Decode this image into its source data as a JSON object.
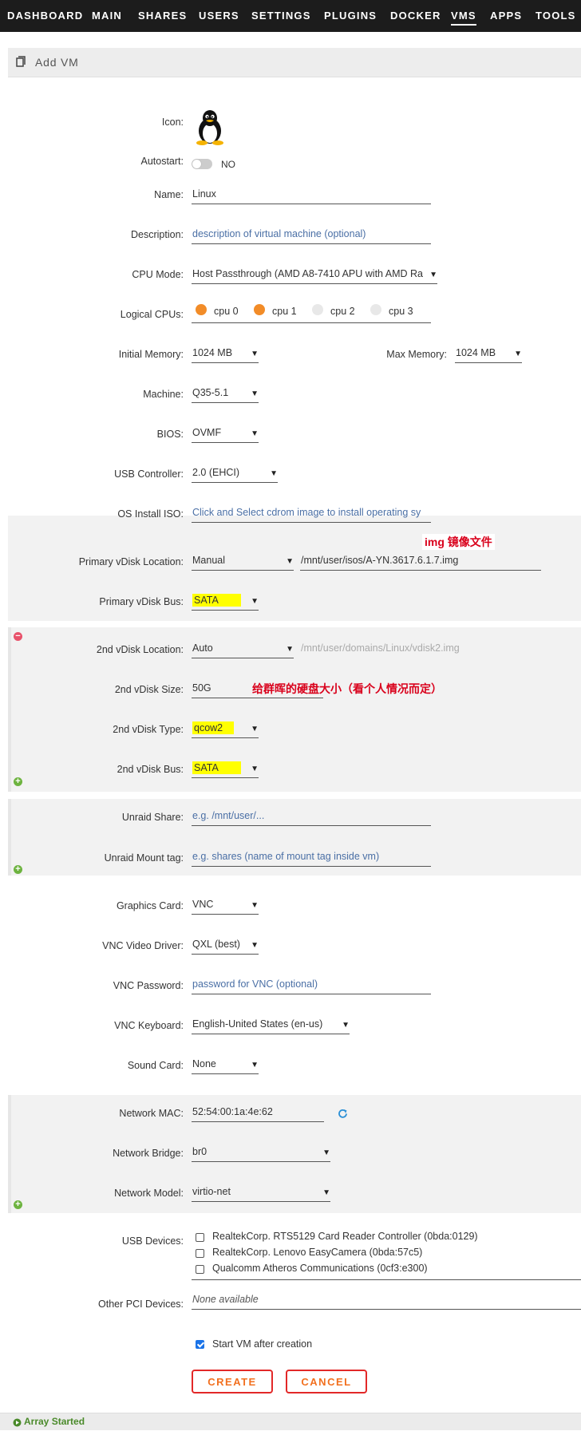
{
  "nav": [
    "DASHBOARD",
    "MAIN",
    "SHARES",
    "USERS",
    "SETTINGS",
    "PLUGINS",
    "DOCKER",
    "VMS",
    "APPS",
    "TOOLS"
  ],
  "nav_active": "VMS",
  "page": {
    "title": "Add VM"
  },
  "form": {
    "icon_label": "Icon:",
    "autostart_label": "Autostart:",
    "autostart_value": "NO",
    "name_label": "Name:",
    "name_value": "Linux",
    "description_label": "Description:",
    "description_placeholder": "description of virtual machine (optional)",
    "cpu_mode_label": "CPU Mode:",
    "cpu_mode_value": "Host Passthrough (AMD A8-7410 APU with AMD Ra",
    "logical_cpus_label": "Logical CPUs:",
    "cpus": [
      {
        "label": "cpu 0",
        "selected": true
      },
      {
        "label": "cpu 1",
        "selected": true
      },
      {
        "label": "cpu 2",
        "selected": false
      },
      {
        "label": "cpu 3",
        "selected": false
      }
    ],
    "initial_memory_label": "Initial Memory:",
    "initial_memory_value": "1024 MB",
    "max_memory_label": "Max Memory:",
    "max_memory_value": "1024 MB",
    "machine_label": "Machine:",
    "machine_value": "Q35-5.1",
    "bios_label": "BIOS:",
    "bios_value": "OVMF",
    "usb_controller_label": "USB Controller:",
    "usb_controller_value": "2.0 (EHCI)",
    "os_iso_label": "OS Install ISO:",
    "os_iso_placeholder": "Click and Select cdrom image to install operating sy",
    "primary_vdisk_location_label": "Primary vDisk Location:",
    "primary_vdisk_location_value": "Manual",
    "primary_vdisk_path": "/mnt/user/isos/A-YN.3617.6.1.7.img",
    "primary_vdisk_bus_label": "Primary vDisk Bus:",
    "primary_vdisk_bus_value": "SATA",
    "vdisk2_location_label": "2nd vDisk Location:",
    "vdisk2_location_value": "Auto",
    "vdisk2_path": "/mnt/user/domains/Linux/vdisk2.img",
    "vdisk2_size_label": "2nd vDisk Size:",
    "vdisk2_size_value": "50G",
    "vdisk2_type_label": "2nd vDisk Type:",
    "vdisk2_type_value": "qcow2",
    "vdisk2_bus_label": "2nd vDisk Bus:",
    "vdisk2_bus_value": "SATA",
    "unraid_share_label": "Unraid Share:",
    "unraid_share_placeholder": "e.g. /mnt/user/...",
    "unraid_mount_tag_label": "Unraid Mount tag:",
    "unraid_mount_tag_placeholder": "e.g. shares (name of mount tag inside vm)",
    "graphics_card_label": "Graphics Card:",
    "graphics_card_value": "VNC",
    "vnc_video_driver_label": "VNC Video Driver:",
    "vnc_video_driver_value": "QXL (best)",
    "vnc_password_label": "VNC Password:",
    "vnc_password_placeholder": "password for VNC (optional)",
    "vnc_keyboard_label": "VNC Keyboard:",
    "vnc_keyboard_value": "English-United States (en-us)",
    "sound_card_label": "Sound Card:",
    "sound_card_value": "None",
    "network_mac_label": "Network MAC:",
    "network_mac_value": "52:54:00:1a:4e:62",
    "network_bridge_label": "Network Bridge:",
    "network_bridge_value": "br0",
    "network_model_label": "Network Model:",
    "network_model_value": "virtio-net",
    "usb_devices_label": "USB Devices:",
    "usb_devices": [
      {
        "label": "RealtekCorp. RTS5129 Card Reader Controller (0bda:0129)",
        "checked": false
      },
      {
        "label": "RealtekCorp. Lenovo EasyCamera (0bda:57c5)",
        "checked": false
      },
      {
        "label": "Qualcomm Atheros Communications (0cf3:e300)",
        "checked": false
      }
    ],
    "other_pci_label": "Other PCI Devices:",
    "other_pci_value": "None available",
    "start_after_label": "Start VM after creation",
    "start_after_checked": true
  },
  "buttons": {
    "create": "CREATE",
    "cancel": "CANCEL"
  },
  "annotations": {
    "img_prefix": "img",
    "img_text": "镜像文件",
    "disk_size": "给群晖的硬盘大小（看个人情况而定）"
  },
  "footer": {
    "status": "Array Started"
  },
  "colors": {
    "accent": "#f28c28",
    "button_border": "#e22828",
    "button_text": "#f2701f",
    "highlight": "#ffff00",
    "link": "#4a6fa5"
  }
}
